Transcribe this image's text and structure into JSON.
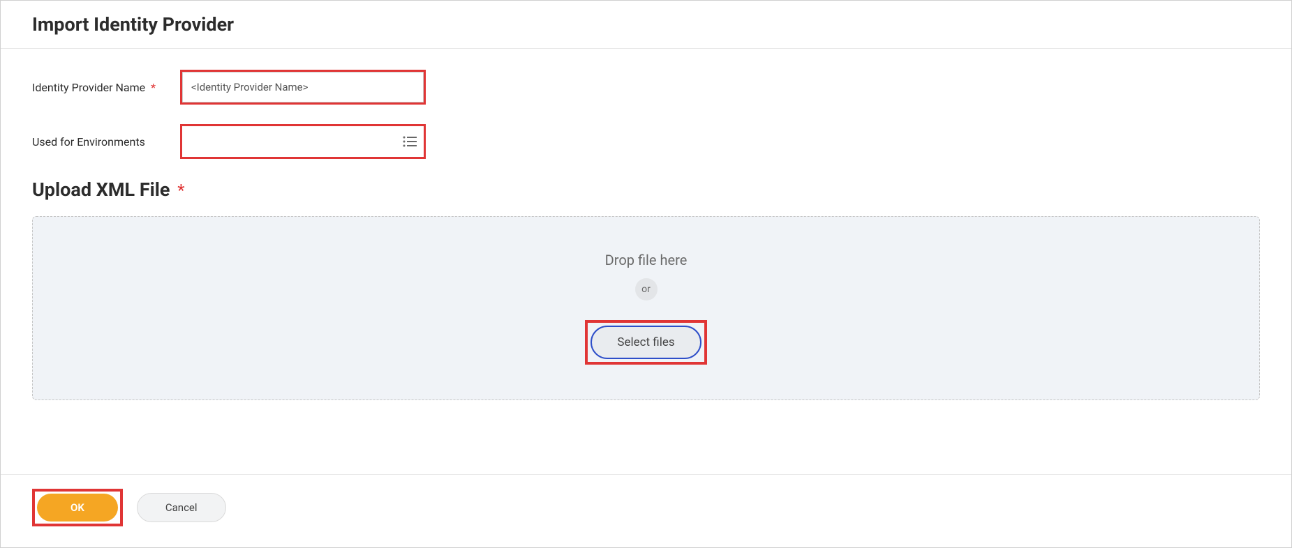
{
  "header": {
    "title": "Import Identity Provider"
  },
  "form": {
    "name_label": "Identity Provider Name",
    "name_value": "<Identity Provider Name>",
    "env_label": "Used for Environments",
    "env_value": ""
  },
  "upload": {
    "heading": "Upload XML File",
    "drop_text": "Drop file here",
    "or_text": "or",
    "select_label": "Select files"
  },
  "footer": {
    "ok_label": "OK",
    "cancel_label": "Cancel"
  }
}
